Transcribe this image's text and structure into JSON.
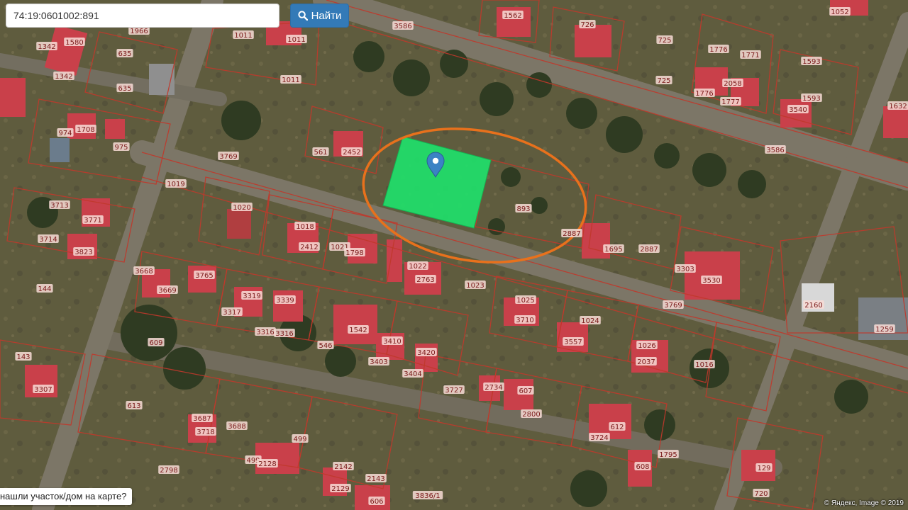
{
  "search": {
    "value": "74:19:0601002:891",
    "button_label": "Найти",
    "button_icon": "search-icon"
  },
  "help_link": "нашли участок/дом на карте?",
  "copyright": "© Яндекс, Image © 2019",
  "colors": {
    "selected_parcel": "#1fe06a",
    "highlight_ellipse": "#e8711c",
    "parcel_boundary": "#c0392b",
    "marker": "#3b82c4",
    "button": "#337ab7"
  },
  "map": {
    "selected_parcel_number": "893",
    "parcel_labels": [
      "1966",
      "1580",
      "1342",
      "1342",
      "635",
      "635",
      "1011",
      "1011",
      "1011",
      "3586",
      "1562",
      "726",
      "725",
      "725",
      "1776",
      "1776",
      "2058",
      "1771",
      "1777",
      "1593",
      "1593",
      "1052",
      "1632",
      "3540",
      "974",
      "1708",
      "975",
      "561",
      "2452",
      "3769",
      "3586",
      "1019",
      "3713",
      "3771",
      "3714",
      "3823",
      "1020",
      "1018",
      "2412",
      "1021",
      "1798",
      "893",
      "2887",
      "1695",
      "2887",
      "3303",
      "3530",
      "144",
      "3668",
      "3669",
      "3765",
      "3317",
      "3319",
      "3339",
      "3316",
      "3316",
      "1022",
      "2763",
      "1023",
      "1025",
      "3710",
      "3769",
      "2160",
      "1259",
      "143",
      "609",
      "1542",
      "546",
      "3410",
      "3403",
      "3420",
      "3404",
      "1024",
      "3557",
      "1026",
      "2037",
      "1016",
      "3307",
      "613",
      "3687",
      "3718",
      "3688",
      "499",
      "499",
      "2128",
      "2142",
      "2129",
      "2143",
      "606",
      "3727",
      "2734",
      "607",
      "2800",
      "612",
      "3724",
      "608",
      "1795",
      "129",
      "720",
      "3836/1",
      "2798"
    ]
  }
}
